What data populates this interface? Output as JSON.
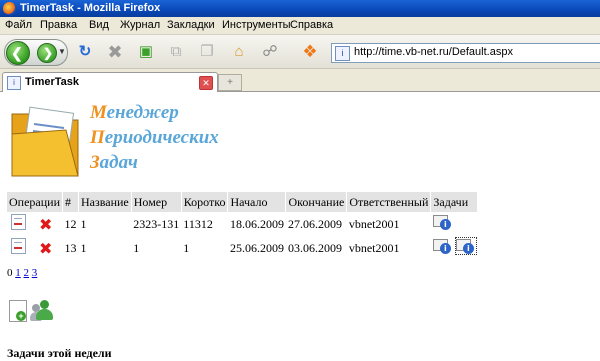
{
  "window": {
    "title": "TimerTask - Mozilla Firefox"
  },
  "menu": [
    "Файл",
    "Правка",
    "Вид",
    "Журнал",
    "Закладки",
    "Инструменты",
    "Справка"
  ],
  "toolbar": {
    "back": "back-icon",
    "forward": "forward-icon",
    "reload": "reload-icon",
    "stop": "stop-icon",
    "url": "http://time.vb-net.ru/Default.aspx"
  },
  "tab": {
    "label": "TimerTask"
  },
  "logo": {
    "line1_cap": "М",
    "line1_rest": "енеджер",
    "line2_cap": "П",
    "line2_rest": "ериодических",
    "line3_cap": "З",
    "line3_rest": "адач"
  },
  "table": {
    "headers": [
      "Операции",
      "#",
      "Название",
      "Номер",
      "Коротко",
      "Начало",
      "Окончание",
      "Ответственный",
      "Задачи"
    ],
    "rows": [
      {
        "id": "12",
        "name": "1",
        "number": "2323-131",
        "short": "11312",
        "start": "18.06.2009",
        "end": "27.06.2009",
        "owner": "vbnet2001"
      },
      {
        "id": "13",
        "name": "1",
        "number": "1",
        "short": "1",
        "start": "25.06.2009",
        "end": "03.06.2009",
        "owner": "vbnet2001"
      }
    ]
  },
  "pager": {
    "current": "0",
    "pages": [
      "1",
      "2",
      "3"
    ]
  },
  "section": {
    "week_title": "Задачи этой недели"
  }
}
